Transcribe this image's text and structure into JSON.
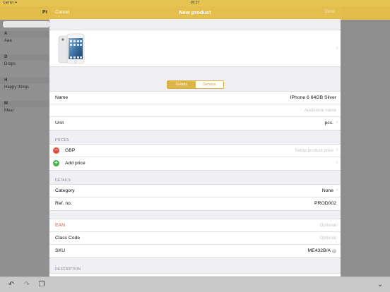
{
  "status": {
    "carrier": "Carrier ✈",
    "time": "06:37"
  },
  "background": {
    "title": "Pr",
    "sections": [
      {
        "header": "A",
        "item": "Aaa"
      },
      {
        "header": "D",
        "item": "Drops"
      },
      {
        "header": "H",
        "item": "Happy things"
      },
      {
        "header": "M",
        "item": "Meat"
      }
    ]
  },
  "modal": {
    "nav": {
      "cancel": "Cancel",
      "title": "New product",
      "save": "Done"
    },
    "segment": {
      "goods": "Goods",
      "service": "Service"
    },
    "name": {
      "label": "Name",
      "value": "IPhone 6 64GB Silver",
      "additional_placeholder": "Additional name"
    },
    "unit": {
      "label": "Unit",
      "value": "pcs."
    },
    "prices": {
      "header": "PRICES",
      "currency": "GBP",
      "currency_placeholder": "Setup product price",
      "add_label": "Add price"
    },
    "details": {
      "header": "DETAILS",
      "category_label": "Category",
      "category_value": "None",
      "ref_label": "Ref. no.",
      "ref_value": "PROD002"
    },
    "codes": {
      "ean_label": "EAN",
      "ean_placeholder": "Optional",
      "class_label": "Class Code",
      "class_placeholder": "Optional",
      "sku_label": "SKU",
      "sku_value": "ME432B/A"
    },
    "description": {
      "header": "DESCRIPTION"
    }
  },
  "colors": {
    "accent": "#e5bf4d",
    "danger": "#e74c3c",
    "success": "#4cb050"
  },
  "icons": {
    "undo": "undo-icon",
    "redo": "redo-icon",
    "copy": "copy-icon",
    "collapse": "chevron-down-icon"
  }
}
